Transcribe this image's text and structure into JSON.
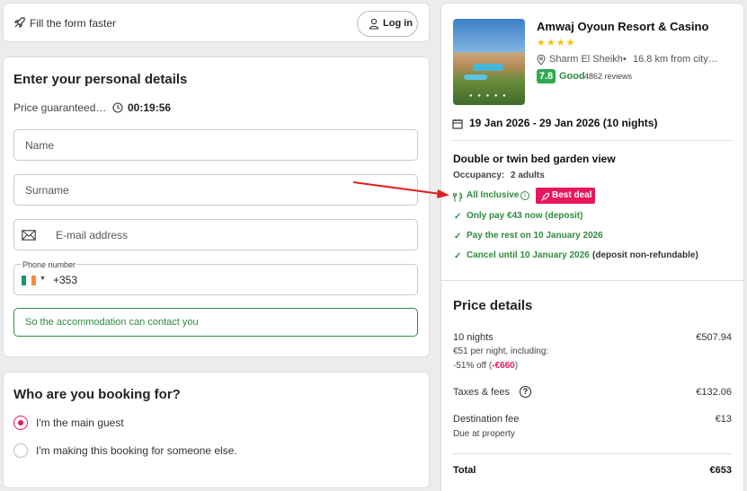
{
  "autofill": {
    "text": "Fill the form faster",
    "login_label": "Log in"
  },
  "personal": {
    "heading": "Enter your personal details",
    "price_guaranteed": "Price guaranteed…",
    "timer": "00:19:56",
    "name_placeholder": "Name",
    "surname_placeholder": "Surname",
    "email_placeholder": "E-mail address",
    "phone_label": "Phone number",
    "phone_code": "+353",
    "contact_note": "So the accommodation can contact you"
  },
  "booking_for": {
    "heading": "Who are you booking for?",
    "options": [
      "I'm the main guest",
      "I'm making this booking for someone else."
    ],
    "selected_index": 0
  },
  "hotel": {
    "name": "Amwaj Oyoun Resort & Casino",
    "stars": 4,
    "location": "Sharm El Sheikh",
    "distance": "16.8 km from city…",
    "rating": "7.8",
    "rating_word": "Good",
    "reviews": "4862 reviews",
    "dates": "19 Jan 2026 - 29 Jan 2026 (10 nights)",
    "room": "Double or twin bed garden view",
    "occupancy_label": "Occupancy:",
    "occupancy_value": "2 adults",
    "board": "All Inclusive",
    "best_deal": "Best deal",
    "perks": [
      "Only pay €43 now (deposit)",
      "Pay the rest on 10 January 2026"
    ],
    "cancel": "Cancel until 10 January 2026",
    "cancel_note": "(deposit non-refundable)"
  },
  "price": {
    "heading": "Price details",
    "nights_label": "10 nights",
    "nights_value": "€507.94",
    "per_night": "€51 per night, including:",
    "discount_prefix": "-51% off (",
    "discount_value": "-€660",
    "discount_suffix": ")",
    "taxes_label": "Taxes & fees",
    "taxes_value": "€132.06",
    "destination_label": "Destination fee",
    "destination_value": "€13",
    "due_note": "Due at property",
    "total_label": "Total",
    "total_value": "€653"
  },
  "colors": {
    "accent": "#e8175d",
    "green": "#2e8b3d",
    "rating_bg": "#2fa84f",
    "star": "#f3c20e",
    "arrow": "#e02020"
  }
}
